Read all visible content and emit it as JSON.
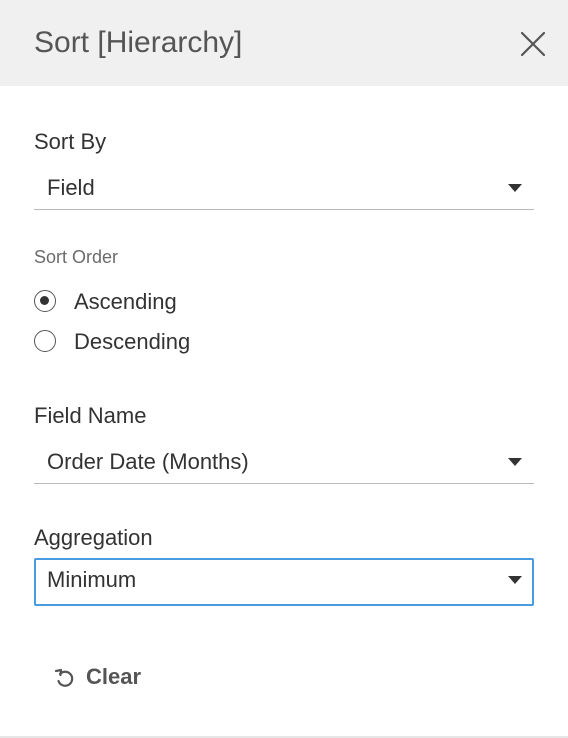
{
  "dialog": {
    "title": "Sort [Hierarchy]",
    "close_icon": "close-icon"
  },
  "sort_by": {
    "label": "Sort By",
    "value": "Field"
  },
  "sort_order": {
    "label": "Sort Order",
    "options": [
      {
        "label": "Ascending",
        "selected": true
      },
      {
        "label": "Descending",
        "selected": false
      }
    ]
  },
  "field_name": {
    "label": "Field Name",
    "value": "Order Date (Months)"
  },
  "aggregation": {
    "label": "Aggregation",
    "value": "Minimum"
  },
  "actions": {
    "clear_label": "Clear",
    "clear_icon": "undo-icon"
  },
  "colors": {
    "header_bg": "#f0f0f0",
    "focus_border": "#4b9be0",
    "text": "#333333"
  }
}
